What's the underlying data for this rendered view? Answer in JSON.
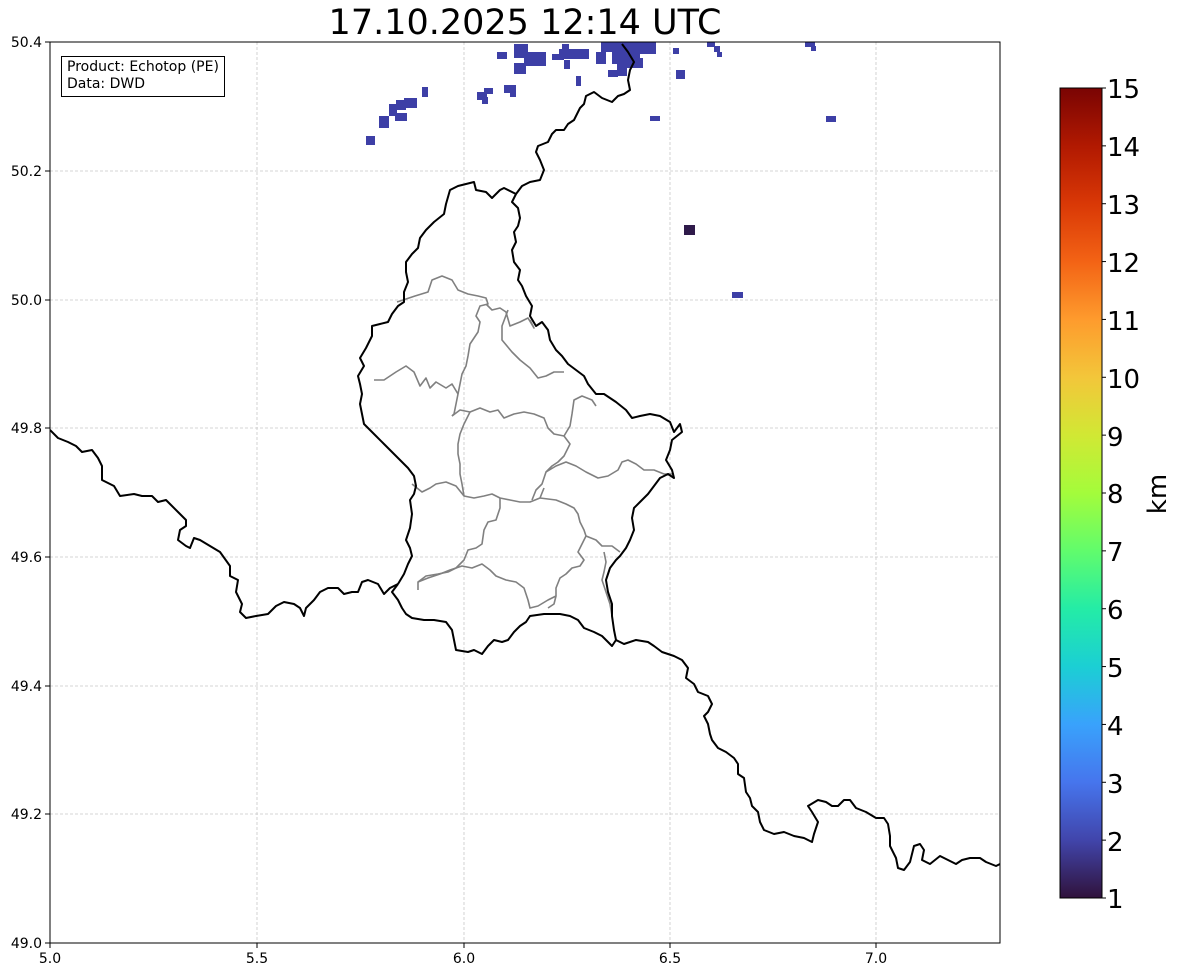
{
  "title": "17.10.2025 12:14 UTC",
  "info": {
    "product": "Product: Echotop (PE)",
    "data_source": "Data: DWD"
  },
  "map": {
    "lon_range": [
      5.0,
      7.3
    ],
    "lat_range": [
      49.0,
      50.4
    ],
    "lon_ticks": [
      "5.0",
      "5.5",
      "6.0",
      "6.5",
      "7.0"
    ],
    "lat_ticks": [
      "50.4",
      "50.2",
      "50.0",
      "49.8",
      "49.6",
      "49.4",
      "49.2",
      "49.0"
    ],
    "grid": true,
    "gridline_color": "#c8c8c8",
    "border_color": "#000000",
    "canton_color": "#808080",
    "echo_color": "#3d3fa6",
    "echo_strong_color": "#2f1a4a"
  },
  "colorbar": {
    "label": "km",
    "min": 1,
    "max": 15,
    "ticks": [
      "15",
      "14",
      "13",
      "12",
      "11",
      "10",
      "9",
      "8",
      "7",
      "6",
      "5",
      "4",
      "3",
      "2",
      "1"
    ],
    "colors": [
      "#30123b",
      "#4145ab",
      "#4675ed",
      "#39a2fc",
      "#1bcfd4",
      "#24eca6",
      "#61fc6c",
      "#a4fc3b",
      "#d1e834",
      "#f3c63a",
      "#fe9b2d",
      "#f36315",
      "#d93806",
      "#b11901",
      "#7a0403"
    ]
  }
}
